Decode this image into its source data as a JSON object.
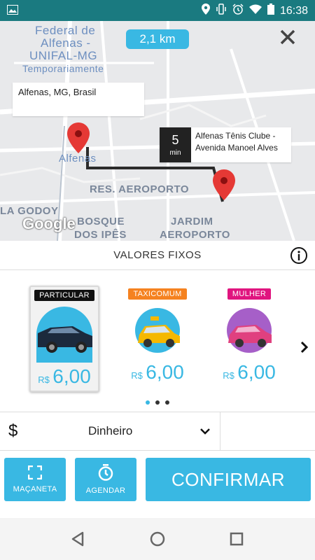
{
  "status_bar": {
    "time": "16:38",
    "icons": [
      "image-icon",
      "location-icon",
      "vibrate-icon",
      "alarm-icon",
      "wifi-icon",
      "battery-icon"
    ]
  },
  "map": {
    "distance": "2,1 km",
    "labels": {
      "federal_1": "Federal de",
      "federal_2": "Alfenas -",
      "federal_3": "UNIFAL-MG",
      "federal_4": "Temporariamente",
      "alfenas": "Alfenas",
      "res_aeroporto": "RES. AEROPORTO",
      "godoy": "LA GODOY",
      "bosque_1": "BOSQUE",
      "bosque_2": "DOS IPÊS",
      "jardim_1": "JARDIM",
      "jardim_2": "AEROPORTO"
    },
    "origin": "Alfenas, MG, Brasil",
    "destination": {
      "minutes": "5",
      "unit": "min",
      "line1": "Alfenas Tênis Clube -",
      "line2": "Avenida Manoel Alves"
    },
    "attribution": "Google"
  },
  "section": {
    "title": "VALORES FIXOS"
  },
  "vehicles": [
    {
      "badge": "PARTICULAR",
      "badge_color": "#111111",
      "currency": "R$",
      "price": "6,00",
      "car_color": "#1c2a3d"
    },
    {
      "badge": "TAXICOMUM",
      "badge_color": "#f58220",
      "currency": "R$",
      "price": "6,00",
      "car_color": "#f5b800"
    },
    {
      "badge": "MULHER",
      "badge_color": "#e0157f",
      "currency": "R$",
      "price": "6,00",
      "car_color": "#e0407f"
    }
  ],
  "payment": {
    "symbol": "$",
    "method": "Dinheiro"
  },
  "actions": {
    "macaneta": "MAÇANETA",
    "agendar": "AGENDAR",
    "confirm": "CONFIRMAR"
  },
  "colors": {
    "accent": "#39b8e3",
    "status_bar": "#1a7a80",
    "pin": "#e53935"
  }
}
